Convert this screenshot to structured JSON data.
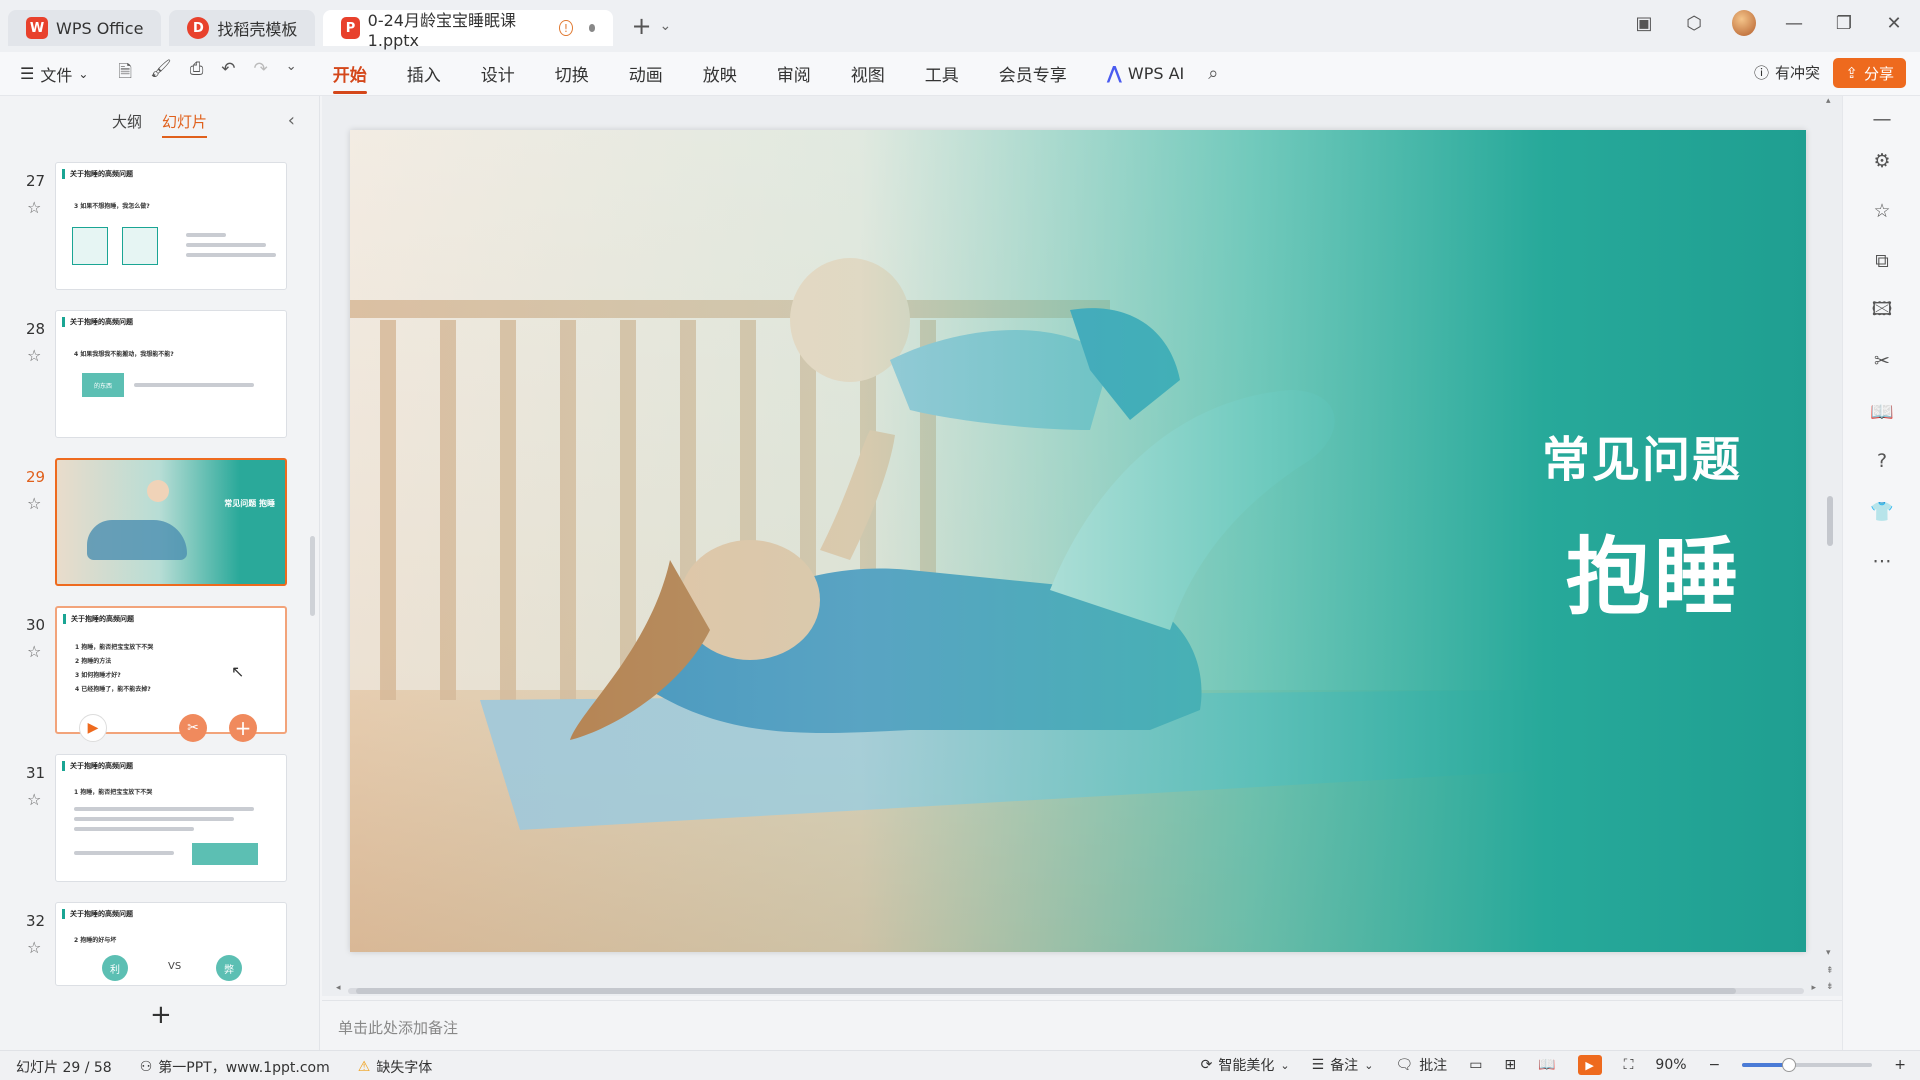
{
  "tabs": [
    {
      "label": "WPS Office",
      "state": "inactive",
      "logo": "W",
      "logo_color": "#e8412c"
    },
    {
      "label": "找稻壳模板",
      "state": "inactive",
      "logo": "D",
      "logo_color": "#e8412c"
    },
    {
      "label": "0-24月龄宝宝睡眠课1.pptx",
      "state": "active",
      "logo": "P",
      "logo_color": "#e8412c"
    }
  ],
  "menubar": {
    "file_label": "文件",
    "items": [
      "开始",
      "插入",
      "设计",
      "切换",
      "动画",
      "放映",
      "审阅",
      "视图",
      "工具",
      "会员专享"
    ],
    "active_item": "开始",
    "wps_ai_label": "WPS AI",
    "conflict_label": "有冲突",
    "share_label": "分享"
  },
  "left_panel": {
    "tab_outline": "大纲",
    "tab_slides": "幻灯片",
    "active_tab": "幻灯片",
    "thumbnails": [
      {
        "number": "27",
        "title": "关于抱睡的高频问题",
        "subtitle": "3 如果不想抱睡，我怎么做?"
      },
      {
        "number": "28",
        "title": "关于抱睡的高频问题",
        "subtitle": "4 如果我想我不能搬动，我想能不能?",
        "box_label": "的东西"
      },
      {
        "number": "29",
        "title": "常见问题 抱睡",
        "selected": true
      },
      {
        "number": "30",
        "title": "关于抱睡的高频问题",
        "lines": [
          "1 抱睡，能否把宝宝放下不哭",
          "2 抱睡的方法",
          "3 如何抱睡才好?",
          "4 已经抱睡了，能不能去掉?"
        ]
      },
      {
        "number": "31",
        "title": "关于抱睡的高频问题",
        "subtitle": "1 抱睡，能否把宝宝放下不哭"
      },
      {
        "number": "32",
        "title": "关于抱睡的高频问题",
        "subtitle": "2 抱睡的好与坏",
        "left_circle": "利",
        "vs": "VS",
        "right_circle": "弊"
      }
    ]
  },
  "slide": {
    "title_line1": "常见问题",
    "title_line2": "抱睡",
    "accent_color": "#27a99a"
  },
  "notes_placeholder": "单击此处添加备注",
  "status": {
    "slide_counter": "幻灯片 29 / 58",
    "theme_label": "第一PPT，www.1ppt.com",
    "missing_font": "缺失字体",
    "smart_beautify": "智能美化",
    "notes_label": "备注",
    "comment_label": "批注",
    "zoom": "90%",
    "zoom_fraction": 0.36
  }
}
